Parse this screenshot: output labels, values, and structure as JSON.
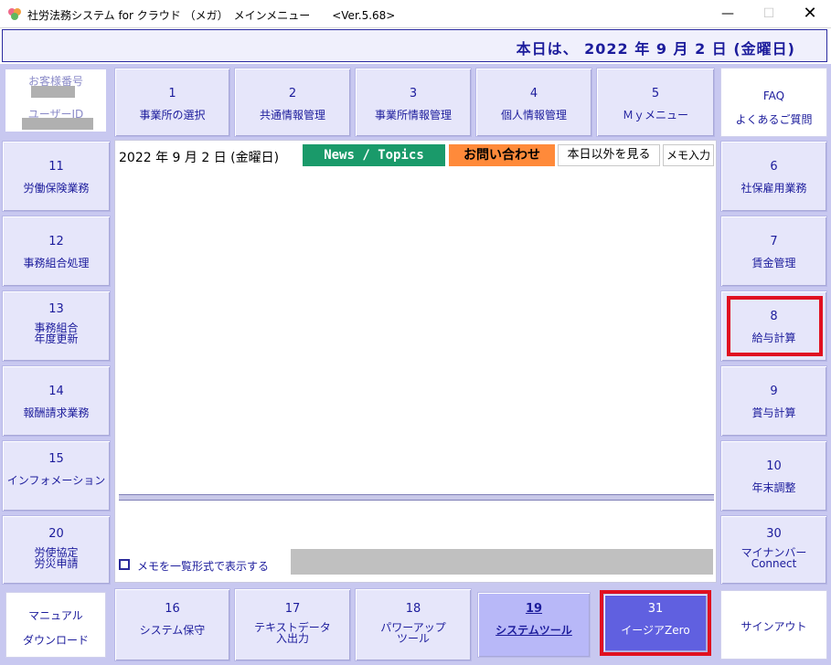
{
  "window": {
    "title": "社労法務システム for クラウド （メガ）　メインメニュー　　<Ver.5.68>",
    "minimize": "—",
    "maximize": "☐",
    "close": "✕"
  },
  "header": {
    "today": "本日は、 2022 年  9 月  2 日 (金曜日)"
  },
  "customer": {
    "number_label": "お客様番号",
    "user_label": "ユーザーID"
  },
  "top_menu": [
    {
      "num": "1",
      "label": "事業所の選択"
    },
    {
      "num": "2",
      "label": "共通情報管理"
    },
    {
      "num": "3",
      "label": "事業所情報管理"
    },
    {
      "num": "4",
      "label": "個人情報管理"
    },
    {
      "num": "5",
      "label": "Ｍｙメニュー"
    }
  ],
  "faq": {
    "top": "FAQ",
    "bottom": "よくあるご質問"
  },
  "left_menu": [
    {
      "num": "11",
      "line1": "労働保険業務",
      "line2": ""
    },
    {
      "num": "12",
      "line1": "事務組合処理",
      "line2": ""
    },
    {
      "num": "13",
      "line1": "事務組合",
      "line2": "年度更新"
    },
    {
      "num": "14",
      "line1": "報酬請求業務",
      "line2": ""
    },
    {
      "num": "15",
      "line1": "インフォメーション",
      "line2": ""
    },
    {
      "num": "20",
      "line1": "労使協定",
      "line2": "労災申請"
    }
  ],
  "right_menu": [
    {
      "num": "6",
      "line1": "社保雇用業務",
      "line2": ""
    },
    {
      "num": "7",
      "line1": "賃金管理",
      "line2": ""
    },
    {
      "num": "8",
      "line1": "給与計算",
      "line2": ""
    },
    {
      "num": "9",
      "line1": "賞与計算",
      "line2": ""
    },
    {
      "num": "10",
      "line1": "年末調整",
      "line2": ""
    },
    {
      "num": "30",
      "line1": "マイナンバー",
      "line2": "Connect"
    }
  ],
  "bottom_menu": {
    "manual": {
      "top": "マニュアル",
      "bottom": "ダウンロード"
    },
    "items": [
      {
        "num": "16",
        "line1": "システム保守",
        "line2": ""
      },
      {
        "num": "17",
        "line1": "テキストデータ",
        "line2": "入出力"
      },
      {
        "num": "18",
        "line1": "パワーアップ",
        "line2": "ツール"
      },
      {
        "num": "19",
        "line1": "システムツール",
        "line2": ""
      },
      {
        "num": "31",
        "line1": "イージアZero",
        "line2": ""
      }
    ],
    "signout": "サインアウト"
  },
  "panel": {
    "date": "2022 年  9 月  2 日 (金曜日)",
    "news": "News / Topics",
    "contact": "お問い合わせ",
    "other_days": "本日以外を見る",
    "memo_input": "メモ入力",
    "memo_list_label": "メモを一覧形式で表示する"
  },
  "colors": {
    "accent_text": "#1c1c9c",
    "frame": "#c8c8f0",
    "tile": "#e6e6fa",
    "news_bg": "#1a9a6a",
    "contact_bg": "#ff8a3a",
    "selected_31": "#6060e0",
    "highlight_red": "#e01020"
  }
}
